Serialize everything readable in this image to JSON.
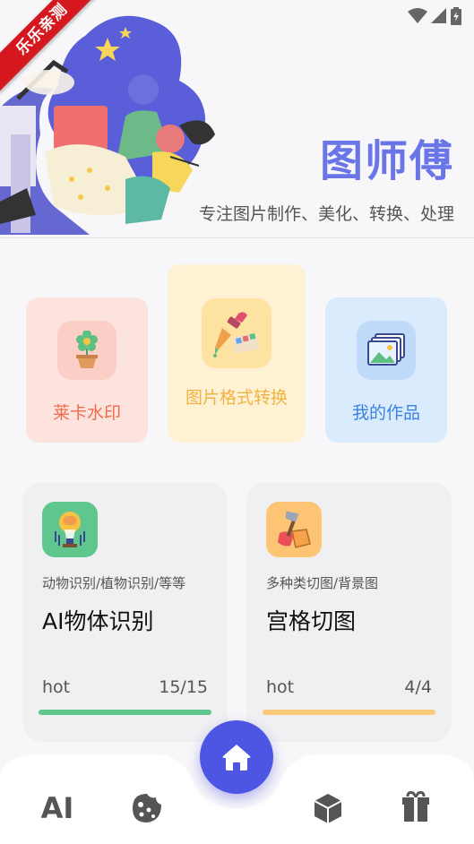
{
  "ribbon": {
    "text": "乐乐亲测"
  },
  "header": {
    "title": "图师傅",
    "subtitle": "专注图片制作、美化、转换、处理"
  },
  "tools": [
    {
      "label": "莱卡水印",
      "icon": "flower-pot-icon",
      "color": "#ee6b4d"
    },
    {
      "label": "图片格式转换",
      "icon": "color-dropper-icon",
      "color": "#f3b340"
    },
    {
      "label": "我的作品",
      "icon": "gallery-icon",
      "color": "#3b82e0"
    }
  ],
  "features": [
    {
      "icon": "lightbulb-brain-icon",
      "description": "动物识别/植物识别/等等",
      "title": "AI物体识别",
      "tag": "hot",
      "count": "15/15",
      "progress": 1.0,
      "bar_color": "#5fc68e"
    },
    {
      "icon": "axe-crate-icon",
      "description": "多种类切图/背景图",
      "title": "宫格切图",
      "tag": "hot",
      "count": "4/4",
      "progress": 1.0,
      "bar_color": "#fccb7a"
    }
  ],
  "bottom_nav": {
    "items": [
      {
        "label": "AI",
        "icon": "ai-text-icon"
      },
      {
        "icon": "cookie-icon"
      },
      {
        "icon": "home-icon"
      },
      {
        "icon": "cube-icon"
      },
      {
        "icon": "gift-icon"
      }
    ]
  }
}
